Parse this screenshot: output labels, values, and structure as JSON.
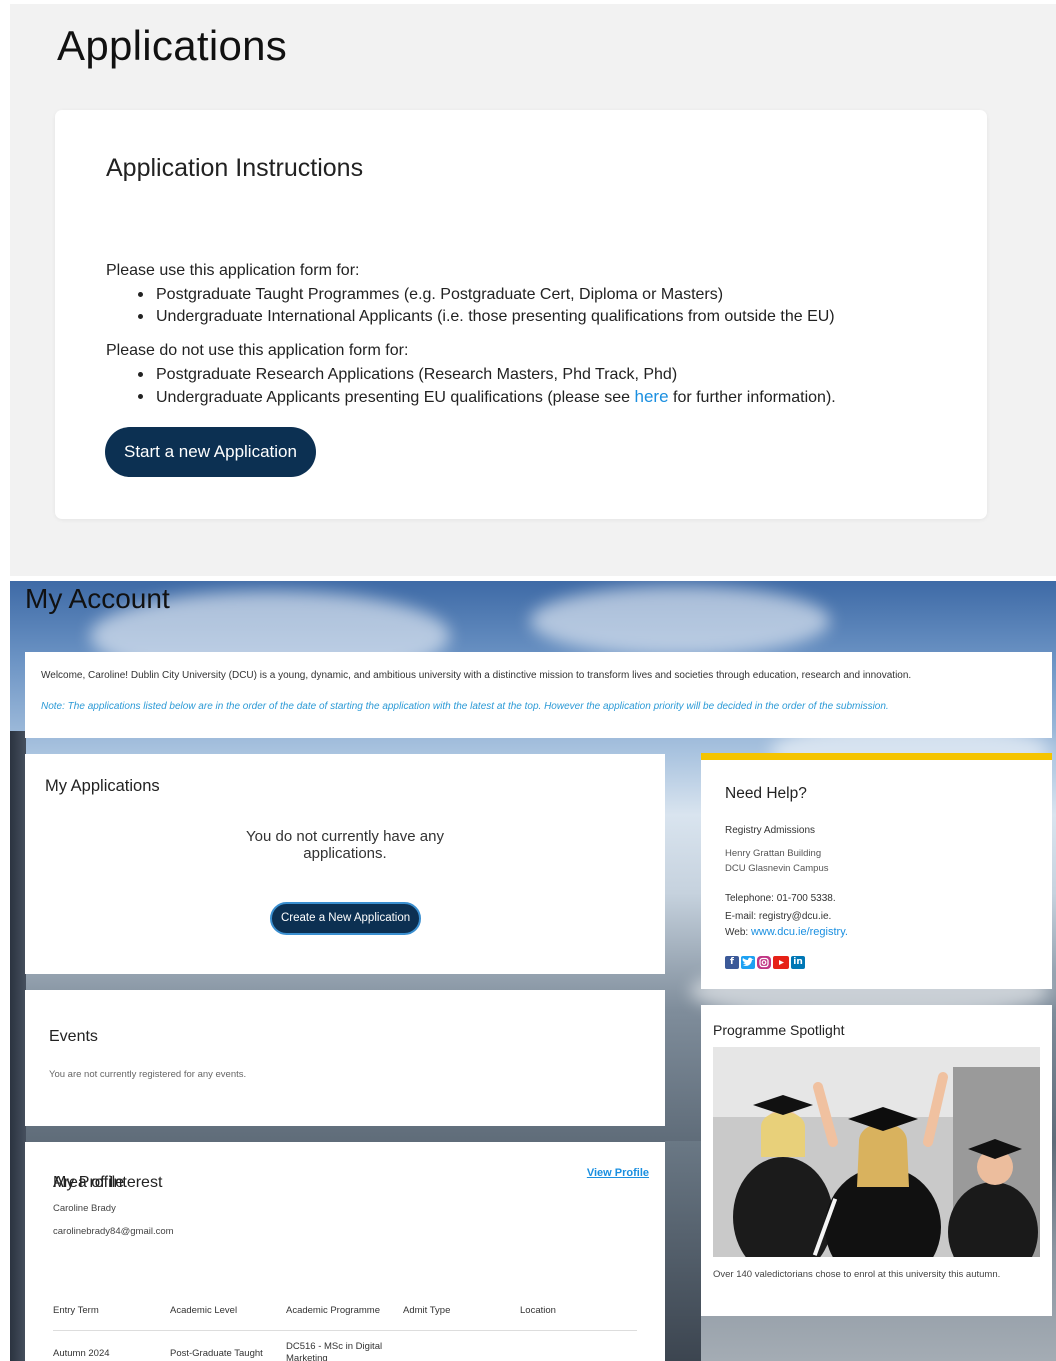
{
  "page": {
    "title": "Applications"
  },
  "instructions": {
    "title": "Application Instructions",
    "use_for_intro": "Please use this application form for:",
    "use_for": [
      "Postgraduate Taught Programmes (e.g. Postgraduate Cert, Diploma or Masters)",
      "Undergraduate International Applicants (i.e. those presenting qualifications from outside the EU)"
    ],
    "not_use_intro": "Please do not use this application form for:",
    "not_use_1": "Postgraduate Research Applications (Research Masters, Phd Track, Phd)",
    "not_use_2_before": "Undergraduate Applicants presenting EU qualifications (please see ",
    "not_use_2_link": "here",
    "not_use_2_after": " for further information).",
    "start_button": "Start a new Application"
  },
  "account": {
    "title": "My Account",
    "welcome": "Welcome, Caroline! Dublin City University (DCU) is a young, dynamic, and ambitious university with a distinctive mission to transform lives and societies through education, research and innovation.",
    "note": "Note: The applications listed below are in the order of the date of starting the application with the latest at the top. However the application priority will be decided in the order of the submission."
  },
  "my_applications": {
    "title": "My Applications",
    "empty": "You do not currently have any applications.",
    "create_button": "Create a New Application"
  },
  "help": {
    "title": "Need Help?",
    "office": "Registry Admissions",
    "address_1": "Henry Grattan Building",
    "address_2": "DCU Glasnevin Campus",
    "telephone": "Telephone: 01-700 5338.",
    "email": "E-mail: registry@dcu.ie.",
    "web_label": "Web: ",
    "web_link": "www.dcu.ie/registry."
  },
  "events": {
    "title": "Events",
    "empty": "You are not currently registered for any events."
  },
  "spotlight": {
    "title": "Programme Spotlight",
    "caption": "Over 140 valedictorians chose to enrol at this university this autumn."
  },
  "profile": {
    "title": "My Profile",
    "view_link": "View Profile",
    "name": "Caroline Brady",
    "email": "carolinebrady84@gmail.com",
    "interest_title": "Area of Interest",
    "columns": [
      "Entry Term",
      "Academic Level",
      "Academic Programme",
      "Admit Type",
      "Location"
    ],
    "row": {
      "entry_term": "Autumn 2024",
      "level": "Post-Graduate Taught",
      "programme_1": "DC516 - MSc in Digital",
      "programme_2": "Marketing"
    }
  }
}
